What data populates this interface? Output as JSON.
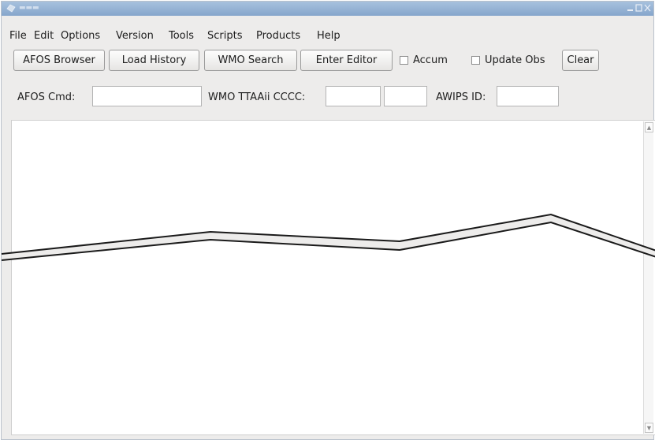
{
  "menu": [
    "File",
    "Edit",
    "Options",
    "Version",
    "Tools",
    "Scripts",
    "Products",
    "Help"
  ],
  "toolbar": {
    "afos_browser": "AFOS Browser",
    "load_history": "Load History",
    "wmo_search": "WMO Search",
    "enter_editor": "Enter Editor",
    "accum": "Accum",
    "update_obs": "Update Obs",
    "clear": "Clear"
  },
  "fields": {
    "afos_cmd_label": "AFOS Cmd:",
    "wmo_label": "WMO TTAAii CCCC:",
    "awips_label": "AWIPS ID:",
    "afos_cmd_value": "",
    "ttaaii_value": "",
    "cccc_value": "",
    "awips_value": ""
  },
  "text_area": {
    "content": ""
  },
  "colors": {
    "titlebar": "#8fadd2",
    "window_bg": "#edeceb",
    "accent_break": "#1a1a1a"
  }
}
